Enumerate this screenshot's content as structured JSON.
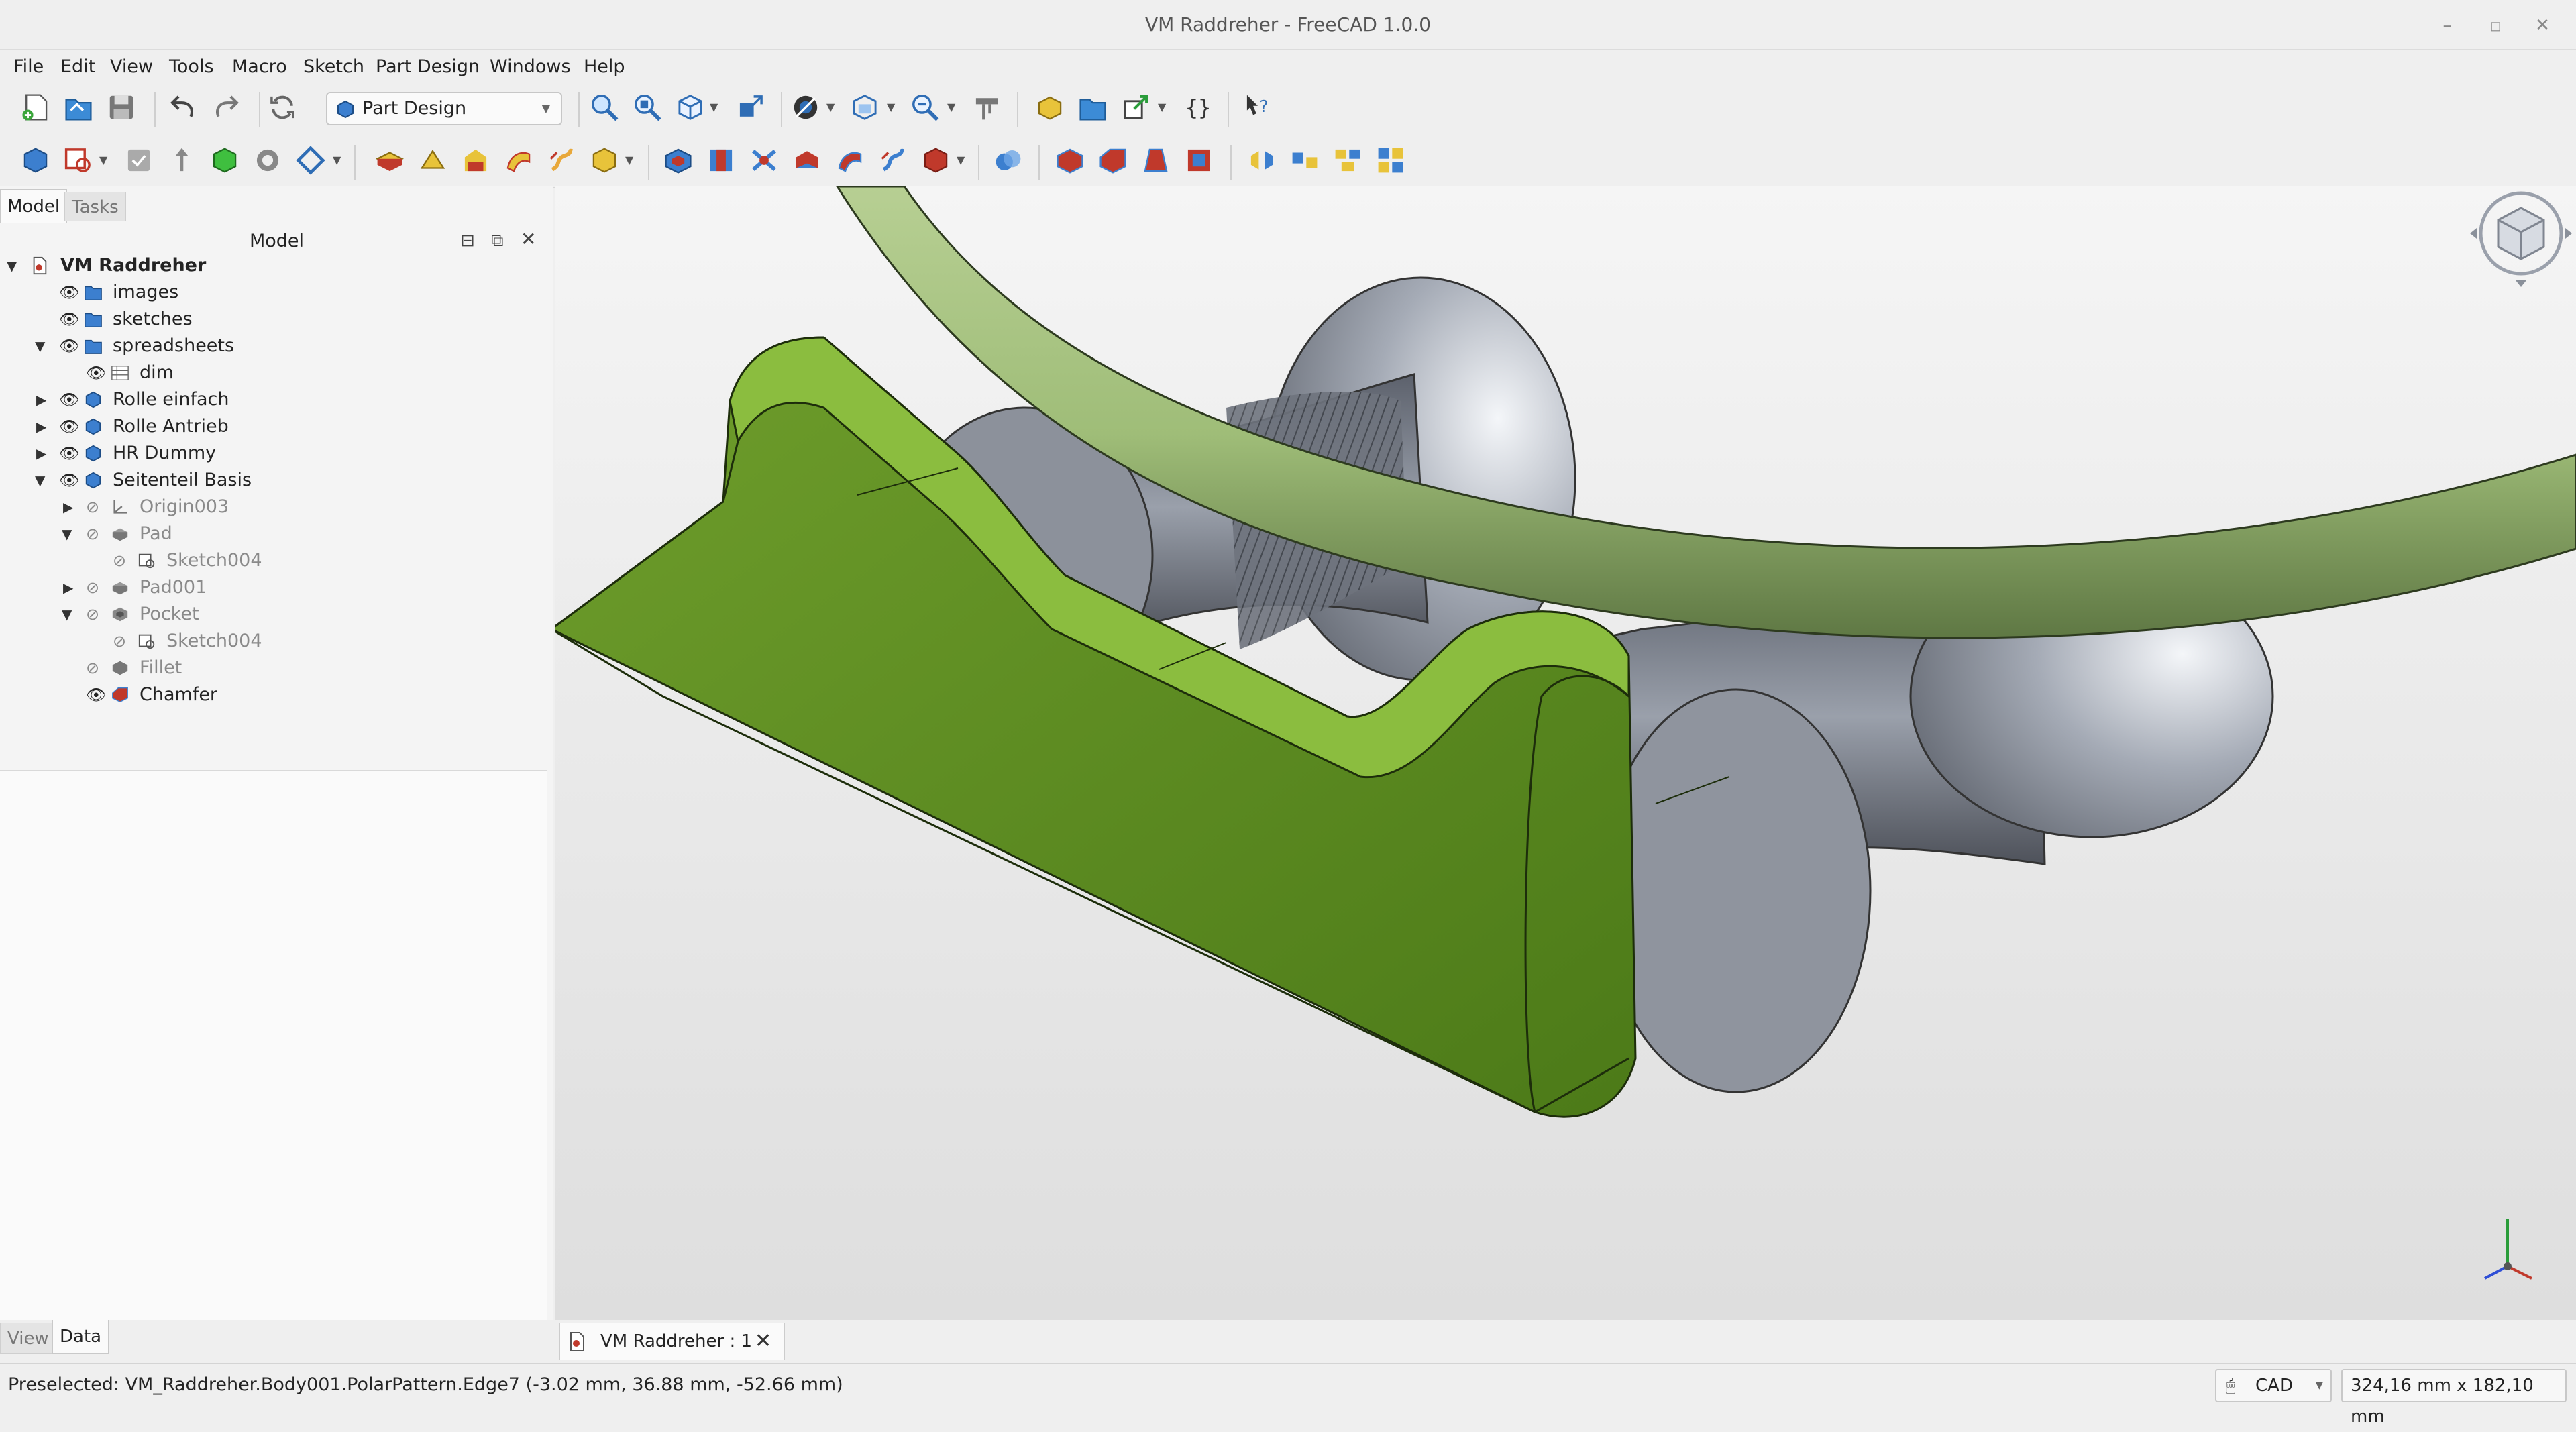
{
  "window": {
    "title": "VM Raddreher - FreeCAD 1.0.0"
  },
  "menu": [
    "File",
    "Edit",
    "View",
    "Tools",
    "Macro",
    "Sketch",
    "Part Design",
    "Windows",
    "Help"
  ],
  "workbench": "Part Design",
  "panel": {
    "tabs": [
      "Model",
      "Tasks"
    ],
    "header": "Model",
    "bottom_tabs": [
      "View",
      "Data"
    ]
  },
  "tree": [
    {
      "label": "VM Raddreher",
      "bold": true,
      "icon": "document-icon"
    },
    {
      "label": "images",
      "icon": "folder-icon"
    },
    {
      "label": "sketches",
      "icon": "folder-icon"
    },
    {
      "label": "spreadsheets",
      "icon": "folder-icon"
    },
    {
      "label": "dim",
      "icon": "spreadsheet-icon"
    },
    {
      "label": "Rolle einfach",
      "icon": "body-icon"
    },
    {
      "label": "Rolle Antrieb",
      "icon": "body-icon"
    },
    {
      "label": "HR Dummy",
      "icon": "body-icon"
    },
    {
      "label": "Seitenteil Basis",
      "icon": "body-icon"
    },
    {
      "label": "Origin003",
      "icon": "origin-icon"
    },
    {
      "label": "Pad",
      "icon": "pad-icon"
    },
    {
      "label": "Sketch004",
      "icon": "sketch-icon"
    },
    {
      "label": "Pad001",
      "icon": "pad-icon"
    },
    {
      "label": "Pocket",
      "icon": "pocket-icon"
    },
    {
      "label": "Sketch004",
      "icon": "sketch-icon"
    },
    {
      "label": "Fillet",
      "icon": "fillet-icon"
    },
    {
      "label": "Chamfer",
      "icon": "chamfer-icon"
    }
  ],
  "document_tab": "VM Raddreher : 1",
  "status": {
    "preselected": "Preselected: VM_Raddreher.Body001.PolarPattern.Edge7 (-3.02 mm, 36.88 mm, -52.66 mm)",
    "nav_style": "CAD",
    "dimensions": "324,16 mm x 182,10 mm"
  },
  "colors": {
    "part_green": "#5a8a22",
    "rod_green": "#a4c07e",
    "roller_grey": "#7d8390",
    "accent_blue": "#2f6db5"
  }
}
